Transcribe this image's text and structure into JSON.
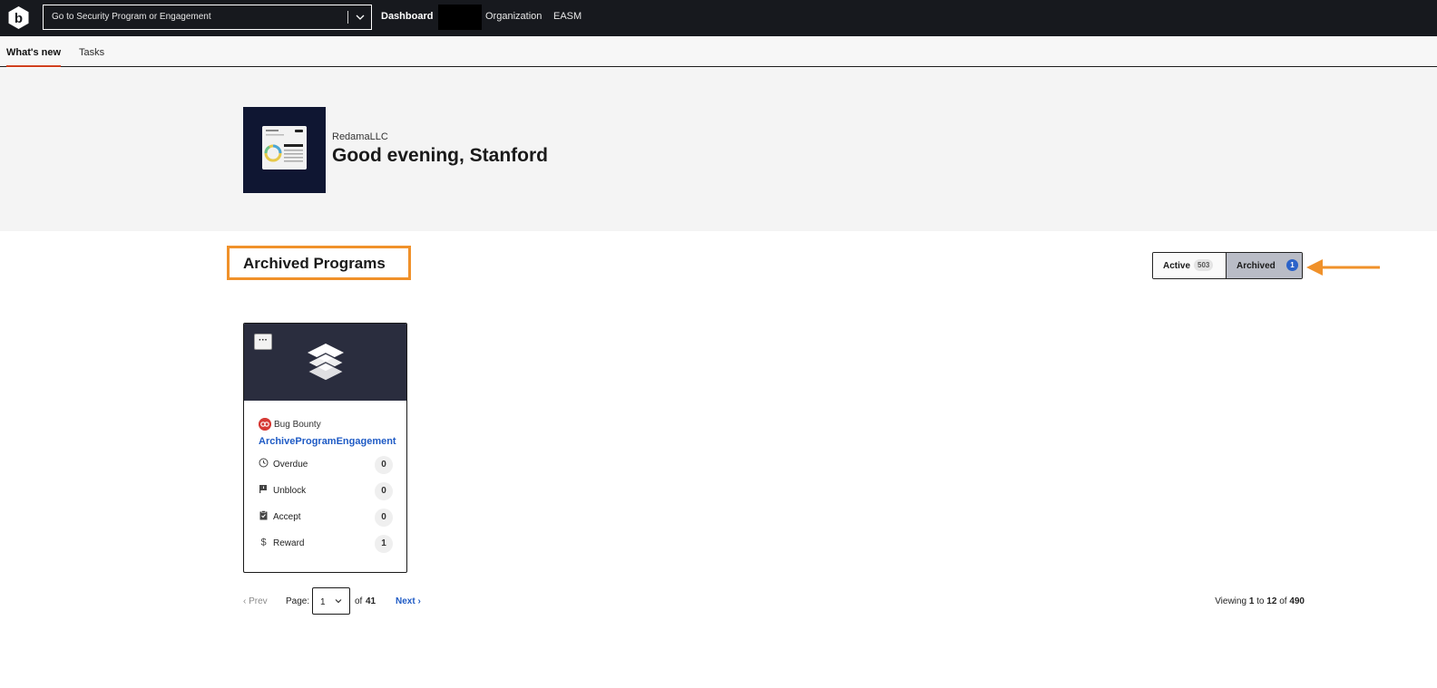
{
  "topbar": {
    "search_placeholder": "Go to Security Program or Engagement",
    "nav": {
      "dashboard": "Dashboard",
      "organization": "Organization",
      "easm": "EASM"
    }
  },
  "tabs": {
    "whats_new": "What's new",
    "tasks": "Tasks"
  },
  "hero": {
    "org_name": "RedamaLLC",
    "greeting": "Good evening, Stanford"
  },
  "section": {
    "title": "Archived Programs"
  },
  "toggle": {
    "active_label": "Active",
    "active_count": "503",
    "archived_label": "Archived",
    "archived_count": "1"
  },
  "card": {
    "menu_label": "···",
    "type": "Bug Bounty",
    "name": "ArchiveProgramEngagement",
    "stats": [
      {
        "label": "Overdue",
        "count": "0",
        "icon": "clock-icon"
      },
      {
        "label": "Unblock",
        "count": "0",
        "icon": "flag-icon"
      },
      {
        "label": "Accept",
        "count": "0",
        "icon": "clipboard-icon"
      },
      {
        "label": "Reward",
        "count": "1",
        "icon": "dollar-icon"
      }
    ]
  },
  "pagination": {
    "prev": "‹ Prev",
    "page_label": "Page:",
    "current_page": "1",
    "of_label": "of",
    "total_pages": "41",
    "next": "Next ›",
    "viewing_prefix": "Viewing",
    "from": "1",
    "to_word": "to",
    "to": "12",
    "of_word": "of",
    "total": "490"
  },
  "colors": {
    "topbar_bg": "#17191e",
    "accent_orange": "#f0912a",
    "link_blue": "#1f5bc5",
    "tab_underline": "#d1401f"
  }
}
